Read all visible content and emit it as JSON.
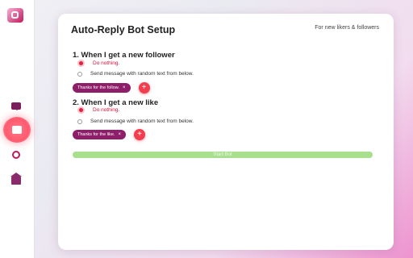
{
  "card": {
    "title": "Auto-Reply Bot Setup",
    "subtitle": "For new likers & followers"
  },
  "sections": [
    {
      "heading": "1. When I get a new follower",
      "options": [
        "Do nothing.",
        "Send message with random text from below."
      ],
      "selected_option": "Do nothing.",
      "chip": "Thanks for the follow.",
      "chip_remove": "×",
      "add": "+"
    },
    {
      "heading": "2. When I get a new like",
      "options": [
        "Do nothing.",
        "Send message with random text from below."
      ],
      "selected_option": "Do nothing.",
      "chip": "Thanks for the like.",
      "chip_remove": "×",
      "add": "+"
    }
  ],
  "start_button": "Start Bot",
  "sidebar": {
    "icons": [
      "app-logo-icon",
      "chat-icon",
      "like-icon",
      "circle-icon",
      "house-icon"
    ],
    "active": "like-icon"
  },
  "colors": {
    "accent": "#e02045",
    "chip": "#8e1d6a",
    "start": "#a7df8e"
  }
}
